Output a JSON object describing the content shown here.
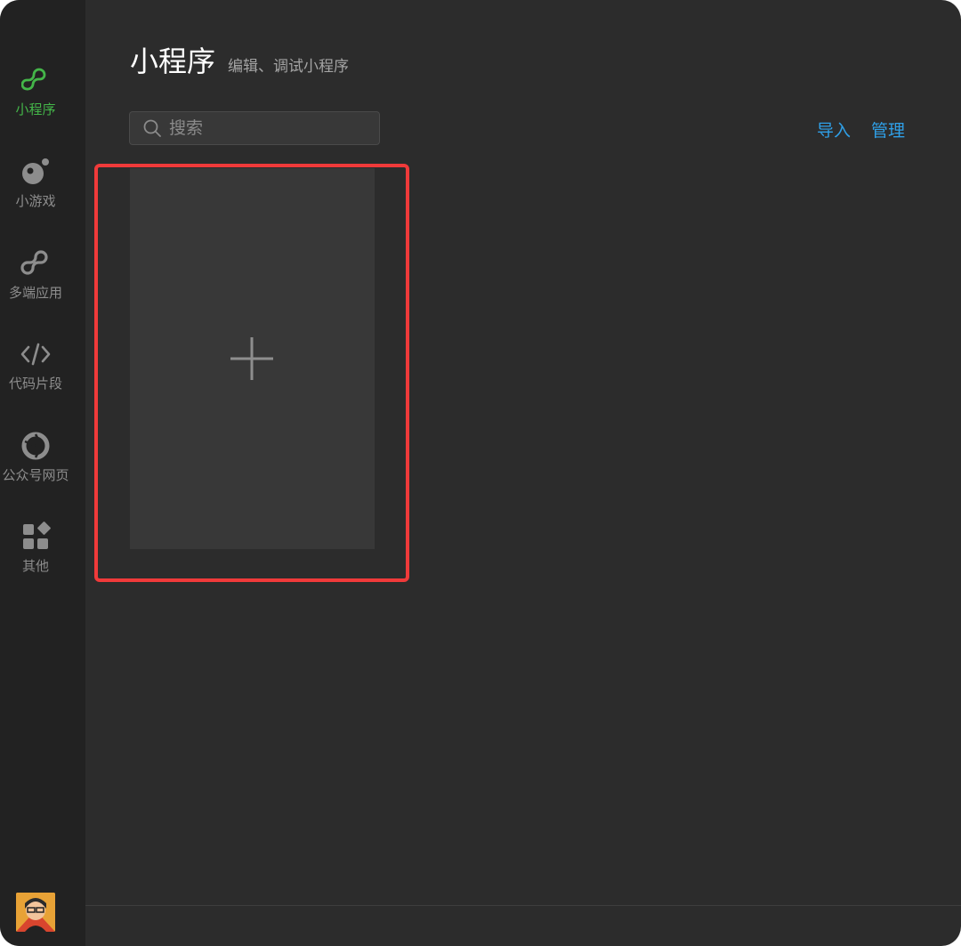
{
  "window": {
    "controls": [
      "close",
      "minimize"
    ]
  },
  "sidebar": {
    "items": [
      {
        "label": "小程序",
        "icon": "miniprogram-icon",
        "active": true
      },
      {
        "label": "小游戏",
        "icon": "minigame-icon",
        "active": false
      },
      {
        "label": "多端应用",
        "icon": "multiplatform-icon",
        "active": false
      },
      {
        "label": "代码片段",
        "icon": "code-icon",
        "active": false
      },
      {
        "label": "公众号网页",
        "icon": "official-account-icon",
        "active": false
      },
      {
        "label": "其他",
        "icon": "apps-grid-icon",
        "active": false
      }
    ],
    "avatar": "user-avatar"
  },
  "header": {
    "title": "小程序",
    "subtitle": "编辑、调试小程序"
  },
  "search": {
    "placeholder": "搜索",
    "value": ""
  },
  "actions": {
    "import_label": "导入",
    "manage_label": "管理"
  },
  "colors": {
    "accent_green": "#44b549",
    "link_blue": "#2fa0e8",
    "highlight_red": "#f03a3a",
    "background": "#2c2c2c",
    "sidebar": "#222222"
  },
  "new_project": {
    "icon": "plus-icon"
  }
}
